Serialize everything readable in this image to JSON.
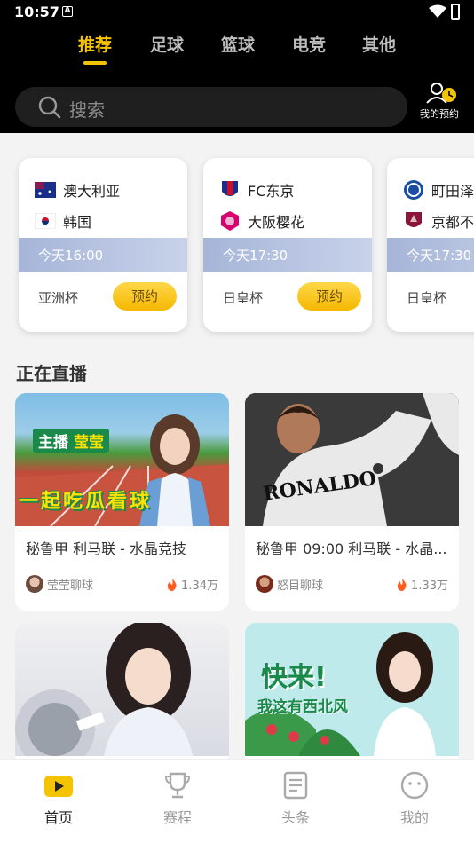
{
  "status": {
    "time": "10:57",
    "notif": "A"
  },
  "tabs": [
    {
      "label": "推荐",
      "active": true
    },
    {
      "label": "足球"
    },
    {
      "label": "篮球"
    },
    {
      "label": "电竞"
    },
    {
      "label": "其他"
    }
  ],
  "search": {
    "placeholder": "搜索"
  },
  "booking": {
    "label": "我的预约"
  },
  "matches": [
    {
      "home": "澳大利亚",
      "away": "韩国",
      "time": "今天16:00",
      "league": "亚洲杯",
      "button": "预约"
    },
    {
      "home": "FC东京",
      "away": "大阪樱花",
      "time": "今天17:30",
      "league": "日皇杯",
      "button": "预约"
    },
    {
      "home": "町田泽",
      "away": "京都不",
      "time": "今天17:30",
      "league": "日皇杯"
    }
  ],
  "live_section": {
    "title": "正在直播"
  },
  "thumb_text": {
    "s1_tag1": "主播",
    "s1_tag2": "莹莹",
    "s1_slogan": "一起吃瓜看球",
    "s2_jersey": "RONALDO",
    "s4_line1": "快来!",
    "s4_line2": "我这有西北风"
  },
  "streams": [
    {
      "title": "秘鲁甲  利马联 - 水晶竞技",
      "host": "莹莹聊球",
      "heat": "1.34万"
    },
    {
      "title": "秘鲁甲 09:00 利马联 - 水晶...",
      "host": "怒目聊球",
      "heat": "1.33万"
    },
    {
      "title": "",
      "host": "",
      "heat": ""
    },
    {
      "title": "",
      "host": "",
      "heat": ""
    }
  ],
  "nav": [
    {
      "label": "首页",
      "active": true
    },
    {
      "label": "赛程"
    },
    {
      "label": "头条"
    },
    {
      "label": "我的"
    }
  ],
  "colors": {
    "accent": "#f5c400",
    "timebar": "#a6b5d8"
  }
}
